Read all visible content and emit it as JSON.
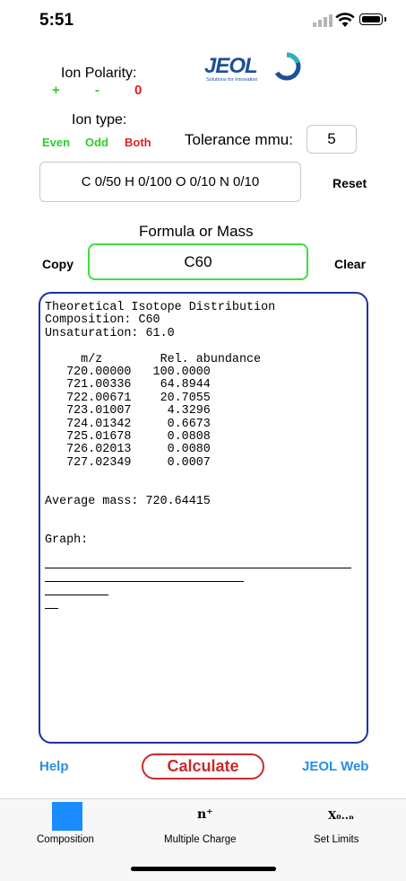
{
  "status_bar": {
    "time": "5:51"
  },
  "ion_polarity": {
    "title": "Ion Polarity:",
    "options": [
      "+",
      "-",
      "0"
    ]
  },
  "logo": {
    "word": "JEOL",
    "tagline": "Solutions for Innovation"
  },
  "ion_type": {
    "title": "Ion type:",
    "options": [
      "Even",
      "Odd",
      "Both"
    ]
  },
  "tolerance": {
    "label": "Tolerance mmu:",
    "value": "5"
  },
  "composition_limits": "C 0/50 H 0/100 O 0/10 N 0/10",
  "reset_label": "Reset",
  "formula": {
    "label": "Formula or Mass",
    "value": "C60",
    "copy_label": "Copy",
    "clear_label": "Clear"
  },
  "output": {
    "text": "Theoretical Isotope Distribution\nComposition: C60\nUnsaturation: 61.0\n\n     m/z        Rel. abundance\n   720.00000   100.0000\n   721.00336    64.8944\n   722.00671    20.7055\n   723.01007     4.3296\n   724.01342     0.6673\n   725.01678     0.0808\n   726.02013     0.0080\n   727.02349     0.0007\n\n\nAverage mass: 720.64415\n\n\nGraph:",
    "graph_bars": [
      100.0,
      64.8944,
      20.7055,
      4.3296
    ]
  },
  "bottom_actions": {
    "help": "Help",
    "calculate": "Calculate",
    "jeol_web": "JEOL Web"
  },
  "tabs": [
    {
      "label": "Composition",
      "icon": "blue-square-icon"
    },
    {
      "label": "Multiple Charge",
      "icon": "n-plus-icon",
      "icon_text": "n⁺"
    },
    {
      "label": "Set Limits",
      "icon": "x-limits-icon",
      "icon_text": "X₀..ₙ"
    }
  ],
  "colors": {
    "accent_blue": "#1a8cff",
    "output_border": "#1c2fa8",
    "formula_border": "#3ee03e",
    "calculate": "#c62b2b",
    "link": "#2a8ee6"
  }
}
